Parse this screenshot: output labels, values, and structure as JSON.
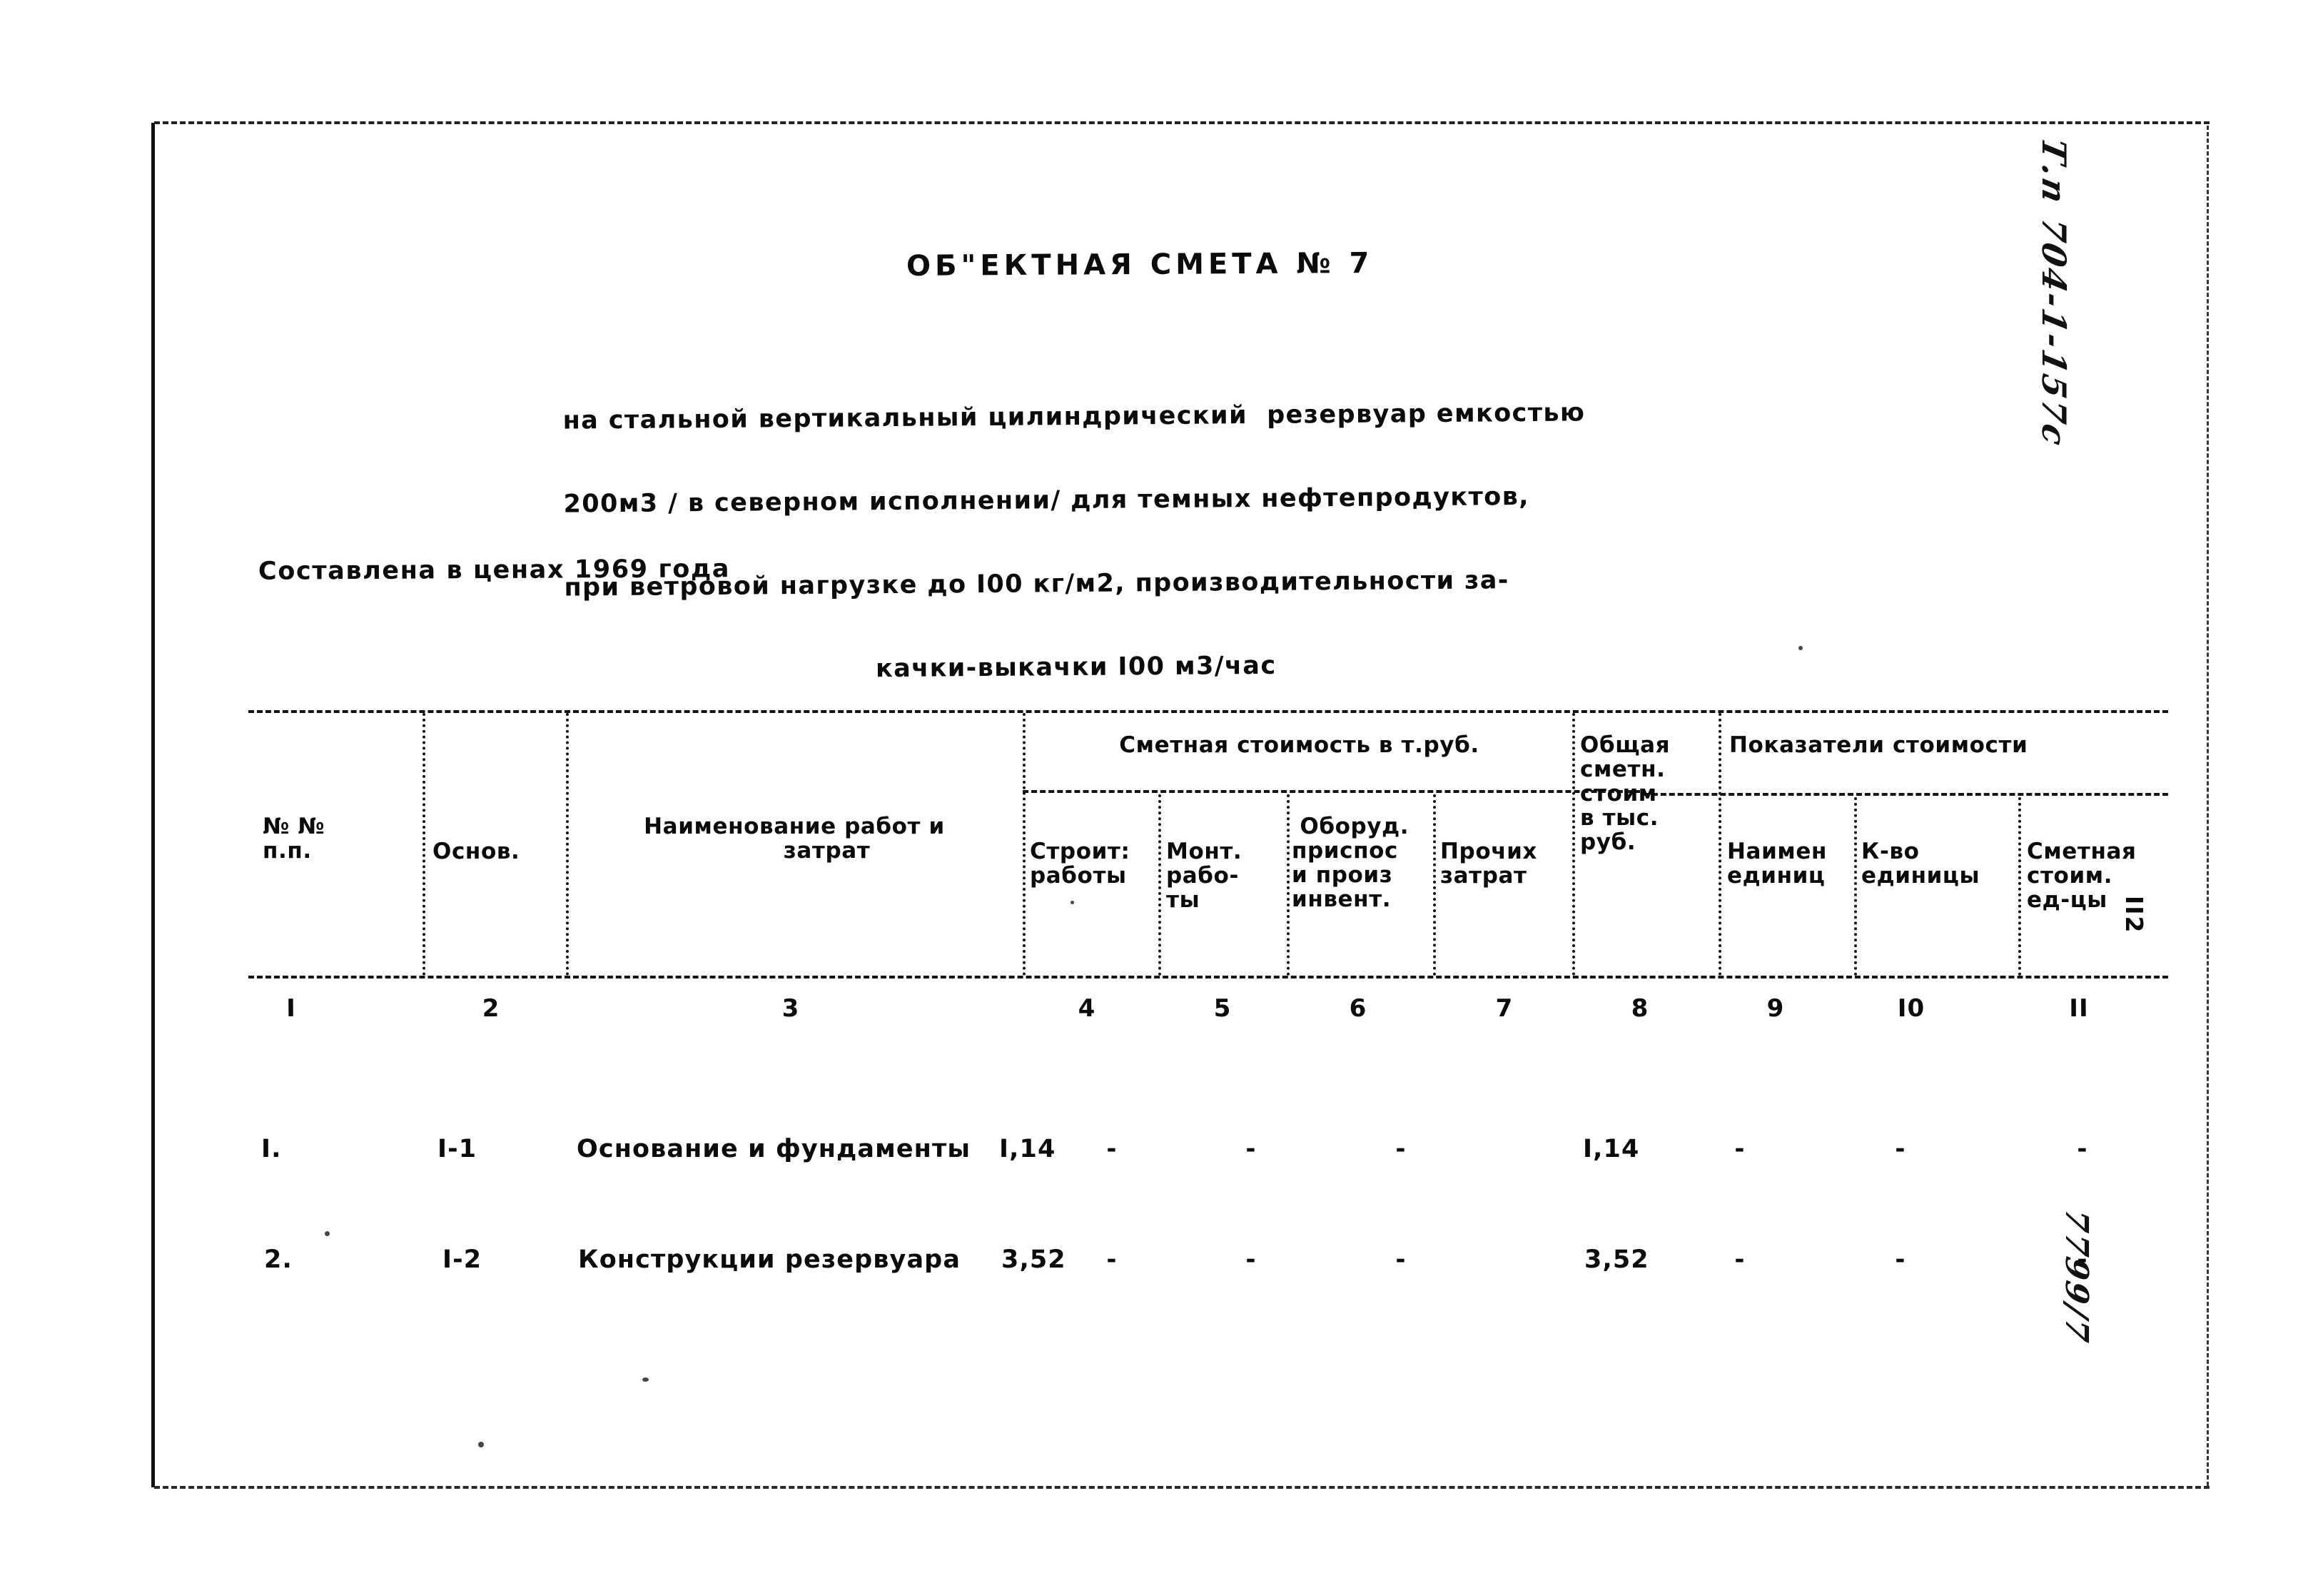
{
  "document": {
    "title": "ОБ\"ЕКТНАЯ СМЕТА № 7",
    "subtitle_lines": [
      "на стальной вертикальный цилиндрический  резервуар емкостью",
      "200м3 / в северном исполнении/ для темных нефтепродуктов,",
      "при ветровой нагрузке до I00 кг/м2, производительности за-",
      "качки-выкачки I00 м3/час"
    ],
    "prices_note": "Составлена в ценах 1969 года",
    "page_number": "II2",
    "margin_code": "Т.п 704-1-157с",
    "margin_archive": "7799/7"
  },
  "table": {
    "group_headers": {
      "estimate_cost": "Сметная стоимость в т.руб.",
      "cost_indicators": "Показатели стоимости"
    },
    "headers": {
      "item_no": "№ №\nп.п.",
      "basis": "Основ.",
      "work_name": "Наименование работ и\n        затрат",
      "construction": "Строит:\nработы",
      "installation": "Монт.\nрабо-\nты",
      "equipment": " Оборуд.\nприспос\nи произ\nинвент.",
      "other": "Прочих\nзатрат",
      "total": "Общая\nсметн.\nстоим\nв тыс.\nруб.",
      "unit_name": "Наимен\nединиц",
      "unit_qty": "К-во\nединицы",
      "unit_cost": "Сметная\nстоим.\nед-цы"
    },
    "column_numbers": [
      "I",
      "2",
      "3",
      "4",
      "5",
      "6",
      "7",
      "8",
      "9",
      "I0",
      "II"
    ],
    "rows": [
      {
        "item_no": "I.",
        "basis": "I-1",
        "work_name": "Основание и фундаменты",
        "construction": "I,14",
        "installation": "-",
        "equipment": "-",
        "other": "-",
        "total": "I,14",
        "unit_name": "-",
        "unit_qty": "-",
        "unit_cost": "-"
      },
      {
        "item_no": "2.",
        "basis": "I-2",
        "work_name": "Конструкции резервуара",
        "construction": "3,52",
        "installation": "-",
        "equipment": "-",
        "other": "-",
        "total": "3,52",
        "unit_name": "-",
        "unit_qty": "-",
        "unit_cost": "-"
      }
    ]
  }
}
